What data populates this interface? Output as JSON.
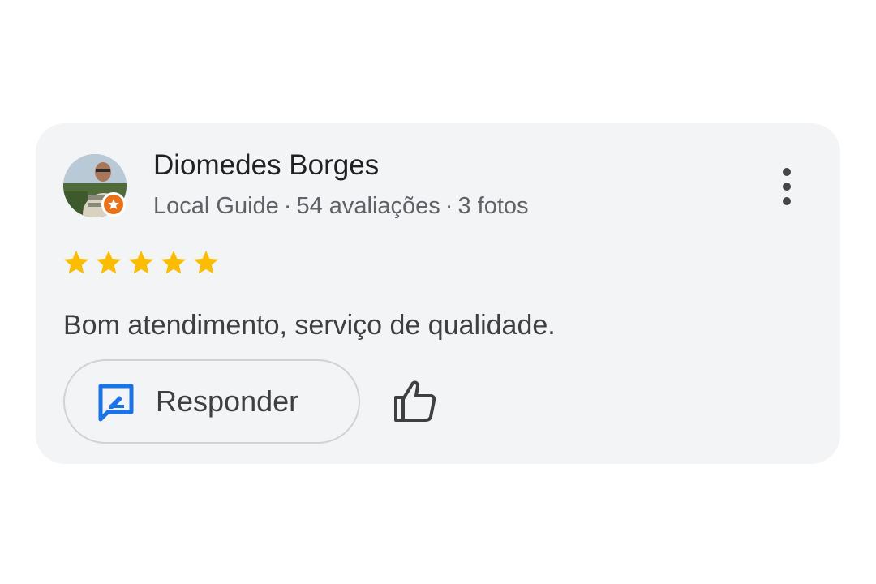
{
  "review_card": {
    "author_name": "Diomedes Borges",
    "author_meta": {
      "badge": "Local Guide",
      "separator": "·",
      "reviews": "54 avaliações",
      "photos": "3 fotos"
    },
    "rating": 5,
    "rating_max": 5,
    "review_text": "Bom atendimento, serviço de qualidade.",
    "reply_label": "Responder"
  },
  "colors": {
    "card_background": "#f3f4f6",
    "star": "#fbbc04",
    "reply_icon": "#1a73e8",
    "guide_badge": "#e8711a"
  },
  "icons": {
    "more": "more-vertical-icon",
    "reply": "reply-icon",
    "like": "thumbs-up-icon",
    "guide": "local-guide-star-icon"
  }
}
